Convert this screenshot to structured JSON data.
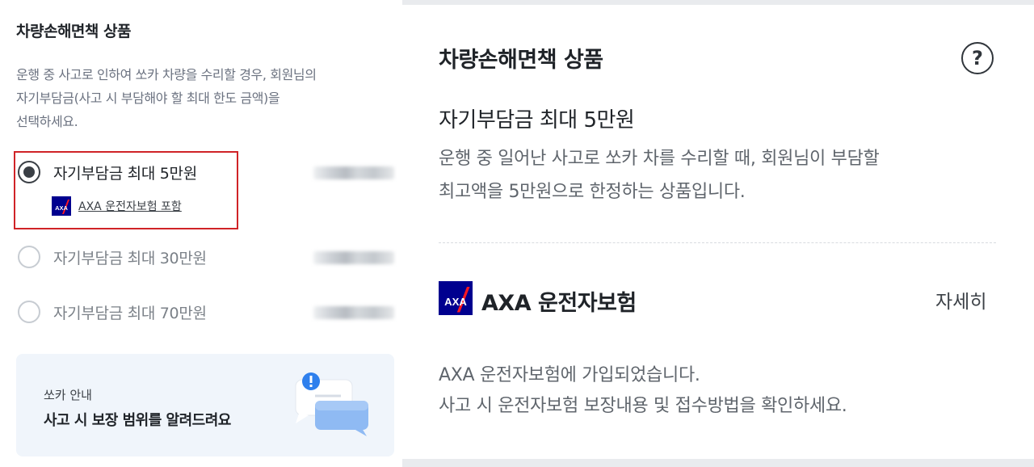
{
  "left": {
    "title": "차량손해면책 상품",
    "description": [
      "운행 중 사고로 인하여 쏘카 차량을 수리할 경우, 회원님의",
      "자기부담금(사고 시 부담해야 할 최대 한도 금액)을",
      "선택하세요."
    ],
    "options": [
      {
        "label": "자기부담금 최대 5만원",
        "selected": true
      },
      {
        "label": "자기부담금 최대 30만원",
        "selected": false
      },
      {
        "label": "자기부담금 최대 70만원",
        "selected": false
      }
    ],
    "axa_link": "AXA 운전자보험 포함",
    "info_card": {
      "subtitle": "쏘카 안내",
      "title": "사고 시 보장 범위를 알려드려요"
    }
  },
  "right": {
    "title": "차량손해면책 상품",
    "heading": "자기부담금 최대 5만원",
    "description": [
      "운행 중 일어난 사고로 쏘카 차를 수리할 때, 회원님이 부담할",
      "최고액을 5만원으로 한정하는 상품입니다."
    ],
    "axa_title": "AXA 운전자보험",
    "detail_link": "자세히",
    "axa_description": [
      "AXA 운전자보험에 가입되었습니다.",
      "사고 시 운전자보험 보장내용 및 접수방법을 확인하세요."
    ]
  },
  "colors": {
    "axa_blue": "#00008f",
    "axa_red": "#ff1721",
    "highlight_border": "#d02327",
    "info_card_bg": "#f0f5fb"
  },
  "icons": {
    "help": "question-circle-icon",
    "axa": "axa-logo-icon",
    "chat": "chat-bubbles-icon"
  }
}
